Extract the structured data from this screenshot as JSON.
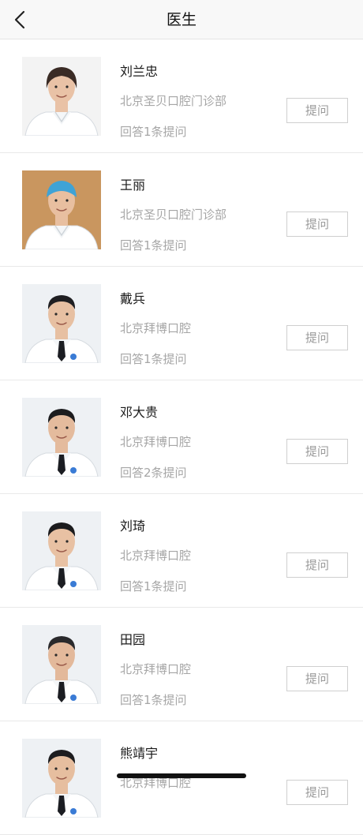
{
  "nav": {
    "title": "医生",
    "back_icon": "chevron-left-icon"
  },
  "doctors": [
    {
      "name": "刘兰忠",
      "clinic": "北京圣贝口腔门诊部",
      "answers": "回答1条提问",
      "action": "提问",
      "photo_bg": "#f3f3f3",
      "skin": "#e9c2a6",
      "hair": "#3a2b25",
      "coat": "#ffffff",
      "cap": null,
      "tie": null,
      "gender": "f"
    },
    {
      "name": "王丽",
      "clinic": "北京圣贝口腔门诊部",
      "answers": "回答1条提问",
      "action": "提问",
      "photo_bg": "#c9965f",
      "skin": "#e8bfa0",
      "hair": "#2c211c",
      "coat": "#ffffff",
      "cap": "#3fa3d6",
      "tie": null,
      "gender": "f"
    },
    {
      "name": "戴兵",
      "clinic": "北京拜博口腔",
      "answers": "回答1条提问",
      "action": "提问",
      "photo_bg": "#eef1f4",
      "skin": "#e7c0a2",
      "hair": "#1f1f22",
      "coat": "#ffffff",
      "cap": null,
      "tie": "#1b1d22",
      "gender": "m"
    },
    {
      "name": "邓大贵",
      "clinic": "北京拜博口腔",
      "answers": "回答2条提问",
      "action": "提问",
      "photo_bg": "#eef1f4",
      "skin": "#e4bb9d",
      "hair": "#1c1c1e",
      "coat": "#ffffff",
      "cap": null,
      "tie": "#1b1d22",
      "gender": "m"
    },
    {
      "name": "刘琦",
      "clinic": "北京拜博口腔",
      "answers": "回答1条提问",
      "action": "提问",
      "photo_bg": "#eef1f4",
      "skin": "#e8c1a3",
      "hair": "#1b1b1d",
      "coat": "#ffffff",
      "cap": null,
      "tie": "#1b1d22",
      "gender": "m"
    },
    {
      "name": "田园",
      "clinic": "北京拜博口腔",
      "answers": "回答1条提问",
      "action": "提问",
      "photo_bg": "#eef1f4",
      "skin": "#e3b99b",
      "hair": "#2a2a2c",
      "coat": "#ffffff",
      "cap": null,
      "tie": "#1b1d22",
      "gender": "m"
    },
    {
      "name": "熊靖宇",
      "clinic": "北京拜博口腔",
      "answers": "",
      "action": "提问",
      "photo_bg": "#eef1f4",
      "skin": "#e6be9f",
      "hair": "#1d1d1f",
      "coat": "#ffffff",
      "cap": null,
      "tie": "#1b1d22",
      "gender": "m"
    }
  ],
  "colors": {
    "text_primary": "#1a1a1a",
    "text_secondary": "#a6a6a6",
    "divider": "#e9e9e9",
    "button_border": "#cfcfcf"
  }
}
